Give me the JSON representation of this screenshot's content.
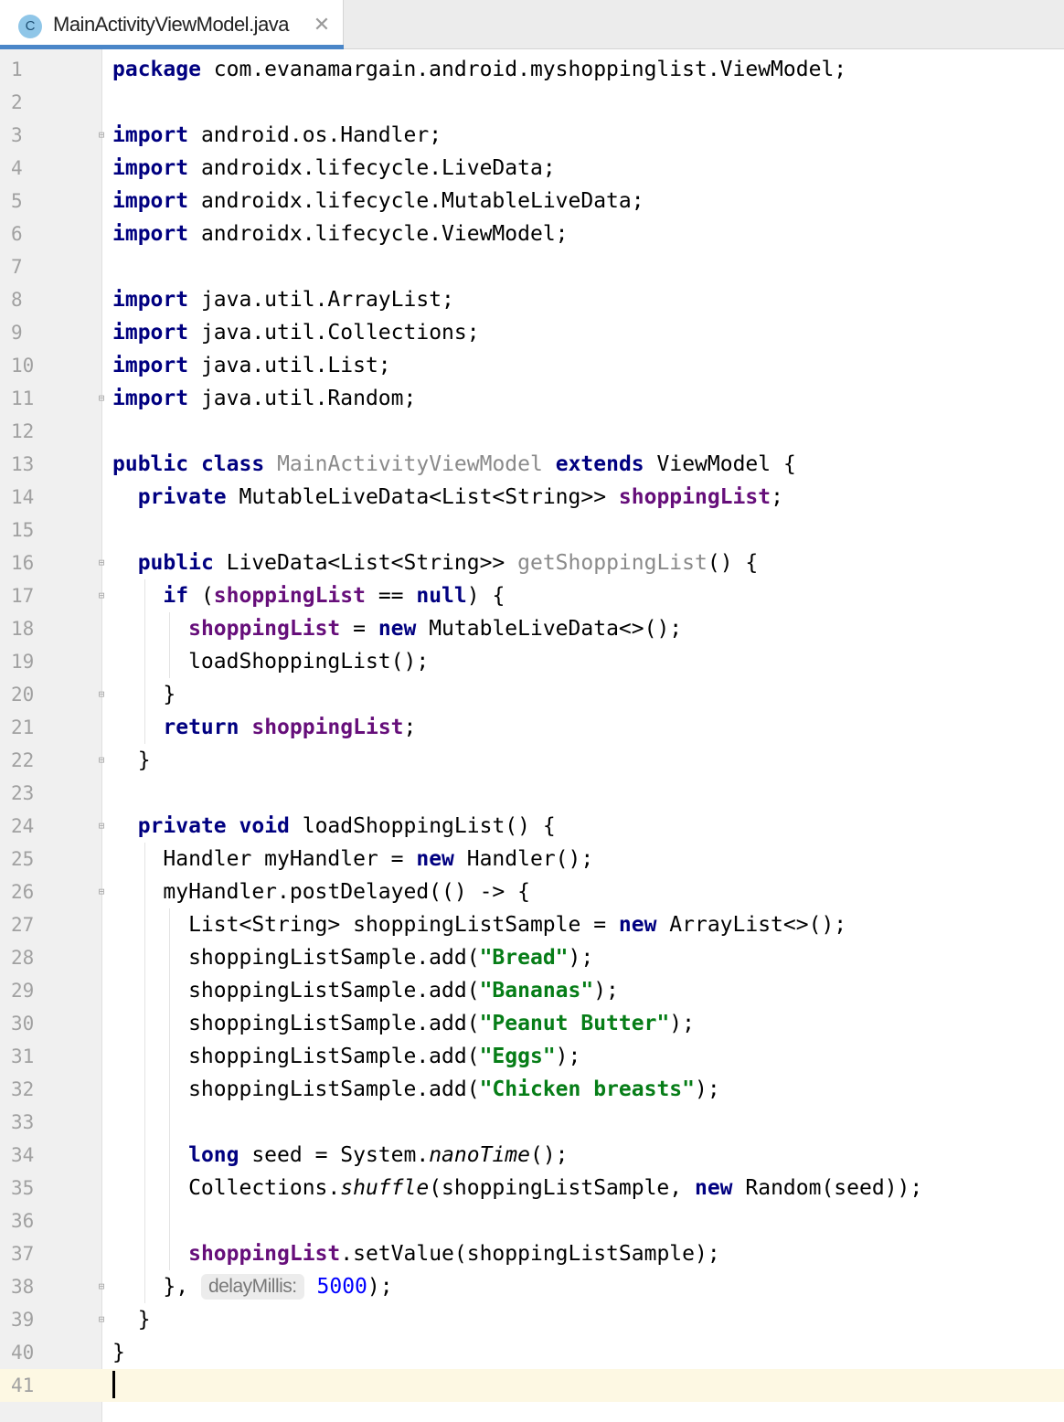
{
  "tab": {
    "icon_letter": "C",
    "title": "MainActivityViewModel.java",
    "close_glyph": "✕"
  },
  "editor": {
    "current_line": 41,
    "lines": [
      {
        "n": "1",
        "fold": "",
        "guides": [],
        "tokens": [
          {
            "t": "package",
            "c": "kw"
          },
          {
            "t": " com.evanamargain.android.myshoppinglist.ViewModel;"
          }
        ]
      },
      {
        "n": "2",
        "fold": "",
        "guides": [],
        "tokens": []
      },
      {
        "n": "3",
        "fold": "open",
        "guides": [],
        "tokens": [
          {
            "t": "import",
            "c": "kw"
          },
          {
            "t": " android.os.Handler;"
          }
        ]
      },
      {
        "n": "4",
        "fold": "",
        "guides": [],
        "tokens": [
          {
            "t": "import",
            "c": "kw"
          },
          {
            "t": " androidx.lifecycle.LiveData;"
          }
        ]
      },
      {
        "n": "5",
        "fold": "",
        "guides": [],
        "tokens": [
          {
            "t": "import",
            "c": "kw"
          },
          {
            "t": " androidx.lifecycle.MutableLiveData;"
          }
        ]
      },
      {
        "n": "6",
        "fold": "",
        "guides": [],
        "tokens": [
          {
            "t": "import",
            "c": "kw"
          },
          {
            "t": " androidx.lifecycle.ViewModel;"
          }
        ]
      },
      {
        "n": "7",
        "fold": "",
        "guides": [],
        "tokens": []
      },
      {
        "n": "8",
        "fold": "",
        "guides": [],
        "tokens": [
          {
            "t": "import",
            "c": "kw"
          },
          {
            "t": " java.util.ArrayList;"
          }
        ]
      },
      {
        "n": "9",
        "fold": "",
        "guides": [],
        "tokens": [
          {
            "t": "import",
            "c": "kw"
          },
          {
            "t": " java.util.Collections;"
          }
        ]
      },
      {
        "n": "10",
        "fold": "",
        "guides": [],
        "tokens": [
          {
            "t": "import",
            "c": "kw"
          },
          {
            "t": " java.util.List;"
          }
        ]
      },
      {
        "n": "11",
        "fold": "close",
        "guides": [],
        "tokens": [
          {
            "t": "import",
            "c": "kw"
          },
          {
            "t": " java.util.Random;"
          }
        ]
      },
      {
        "n": "12",
        "fold": "",
        "guides": [],
        "tokens": []
      },
      {
        "n": "13",
        "fold": "",
        "guides": [],
        "tokens": [
          {
            "t": "public",
            "c": "kw"
          },
          {
            "t": " "
          },
          {
            "t": "class",
            "c": "kw"
          },
          {
            "t": " "
          },
          {
            "t": "MainActivityViewModel",
            "c": "gray"
          },
          {
            "t": " "
          },
          {
            "t": "extends",
            "c": "kw"
          },
          {
            "t": " ViewModel {"
          }
        ]
      },
      {
        "n": "14",
        "fold": "",
        "guides": [],
        "tokens": [
          {
            "t": "  "
          },
          {
            "t": "private",
            "c": "kw"
          },
          {
            "t": " MutableLiveData<List<String>> "
          },
          {
            "t": "shoppingList",
            "c": "fld"
          },
          {
            "t": ";"
          }
        ]
      },
      {
        "n": "15",
        "fold": "",
        "guides": [],
        "tokens": []
      },
      {
        "n": "16",
        "fold": "open",
        "guides": [],
        "tokens": [
          {
            "t": "  "
          },
          {
            "t": "public",
            "c": "kw"
          },
          {
            "t": " LiveData<List<String>> "
          },
          {
            "t": "getShoppingList",
            "c": "gray"
          },
          {
            "t": "() {"
          }
        ]
      },
      {
        "n": "17",
        "fold": "open",
        "guides": [
          2
        ],
        "tokens": [
          {
            "t": "    "
          },
          {
            "t": "if",
            "c": "kw"
          },
          {
            "t": " ("
          },
          {
            "t": "shoppingList",
            "c": "fld"
          },
          {
            "t": " == "
          },
          {
            "t": "null",
            "c": "kw"
          },
          {
            "t": ") {"
          }
        ]
      },
      {
        "n": "18",
        "fold": "",
        "guides": [
          2,
          4
        ],
        "tokens": [
          {
            "t": "      "
          },
          {
            "t": "shoppingList",
            "c": "fld"
          },
          {
            "t": " = "
          },
          {
            "t": "new",
            "c": "kw"
          },
          {
            "t": " MutableLiveData<>();"
          }
        ]
      },
      {
        "n": "19",
        "fold": "",
        "guides": [
          2,
          4
        ],
        "tokens": [
          {
            "t": "      loadShoppingList();"
          }
        ]
      },
      {
        "n": "20",
        "fold": "close",
        "guides": [
          2
        ],
        "tokens": [
          {
            "t": "    }"
          }
        ]
      },
      {
        "n": "21",
        "fold": "",
        "guides": [
          2
        ],
        "tokens": [
          {
            "t": "    "
          },
          {
            "t": "return",
            "c": "kw"
          },
          {
            "t": " "
          },
          {
            "t": "shoppingList",
            "c": "fld"
          },
          {
            "t": ";"
          }
        ]
      },
      {
        "n": "22",
        "fold": "close",
        "guides": [],
        "tokens": [
          {
            "t": "  }"
          }
        ]
      },
      {
        "n": "23",
        "fold": "",
        "guides": [],
        "tokens": []
      },
      {
        "n": "24",
        "fold": "open",
        "guides": [],
        "tokens": [
          {
            "t": "  "
          },
          {
            "t": "private",
            "c": "kw"
          },
          {
            "t": " "
          },
          {
            "t": "void",
            "c": "kw"
          },
          {
            "t": " loadShoppingList() {"
          }
        ]
      },
      {
        "n": "25",
        "fold": "",
        "guides": [
          2
        ],
        "tokens": [
          {
            "t": "    Handler myHandler = "
          },
          {
            "t": "new",
            "c": "kw"
          },
          {
            "t": " Handler();"
          }
        ]
      },
      {
        "n": "26",
        "fold": "open",
        "guides": [
          2
        ],
        "tokens": [
          {
            "t": "    myHandler.postDelayed(() -> {"
          }
        ]
      },
      {
        "n": "27",
        "fold": "",
        "guides": [
          2,
          4
        ],
        "tokens": [
          {
            "t": "      List<String> shoppingListSample = "
          },
          {
            "t": "new",
            "c": "kw"
          },
          {
            "t": " ArrayList<>();"
          }
        ]
      },
      {
        "n": "28",
        "fold": "",
        "guides": [
          2,
          4
        ],
        "tokens": [
          {
            "t": "      shoppingListSample.add("
          },
          {
            "t": "\"Bread\"",
            "c": "str"
          },
          {
            "t": ");"
          }
        ]
      },
      {
        "n": "29",
        "fold": "",
        "guides": [
          2,
          4
        ],
        "tokens": [
          {
            "t": "      shoppingListSample.add("
          },
          {
            "t": "\"Bananas\"",
            "c": "str"
          },
          {
            "t": ");"
          }
        ]
      },
      {
        "n": "30",
        "fold": "",
        "guides": [
          2,
          4
        ],
        "tokens": [
          {
            "t": "      shoppingListSample.add("
          },
          {
            "t": "\"Peanut Butter\"",
            "c": "str"
          },
          {
            "t": ");"
          }
        ]
      },
      {
        "n": "31",
        "fold": "",
        "guides": [
          2,
          4
        ],
        "tokens": [
          {
            "t": "      shoppingListSample.add("
          },
          {
            "t": "\"Eggs\"",
            "c": "str"
          },
          {
            "t": ");"
          }
        ]
      },
      {
        "n": "32",
        "fold": "",
        "guides": [
          2,
          4
        ],
        "tokens": [
          {
            "t": "      shoppingListSample.add("
          },
          {
            "t": "\"Chicken breasts\"",
            "c": "str"
          },
          {
            "t": ");"
          }
        ]
      },
      {
        "n": "33",
        "fold": "",
        "guides": [
          2,
          4
        ],
        "tokens": []
      },
      {
        "n": "34",
        "fold": "",
        "guides": [
          2,
          4
        ],
        "tokens": [
          {
            "t": "      "
          },
          {
            "t": "long",
            "c": "kw"
          },
          {
            "t": " seed = System."
          },
          {
            "t": "nanoTime",
            "c": "it"
          },
          {
            "t": "();"
          }
        ]
      },
      {
        "n": "35",
        "fold": "",
        "guides": [
          2,
          4
        ],
        "tokens": [
          {
            "t": "      Collections."
          },
          {
            "t": "shuffle",
            "c": "it"
          },
          {
            "t": "(shoppingListSample, "
          },
          {
            "t": "new",
            "c": "kw"
          },
          {
            "t": " Random(seed));"
          }
        ]
      },
      {
        "n": "36",
        "fold": "",
        "guides": [
          2,
          4
        ],
        "tokens": []
      },
      {
        "n": "37",
        "fold": "",
        "guides": [
          2,
          4
        ],
        "tokens": [
          {
            "t": "      "
          },
          {
            "t": "shoppingList",
            "c": "fld"
          },
          {
            "t": ".setValue(shoppingListSample);"
          }
        ]
      },
      {
        "n": "38",
        "fold": "close",
        "guides": [
          2
        ],
        "tokens": [
          {
            "t": "    }, "
          },
          {
            "t": "delayMillis:",
            "c": "hint"
          },
          {
            "t": " "
          },
          {
            "t": "5000",
            "c": "num"
          },
          {
            "t": ");"
          }
        ]
      },
      {
        "n": "39",
        "fold": "close",
        "guides": [],
        "tokens": [
          {
            "t": "  }"
          }
        ]
      },
      {
        "n": "40",
        "fold": "",
        "guides": [],
        "tokens": [
          {
            "t": "}"
          }
        ]
      },
      {
        "n": "41",
        "fold": "",
        "guides": [],
        "tokens": []
      }
    ]
  },
  "colors": {
    "keyword": "#000080",
    "field": "#660e7a",
    "string": "#067d17",
    "number": "#0000ff",
    "current_line_bg": "#fdf8e3",
    "tab_underline": "#4a86c8"
  }
}
